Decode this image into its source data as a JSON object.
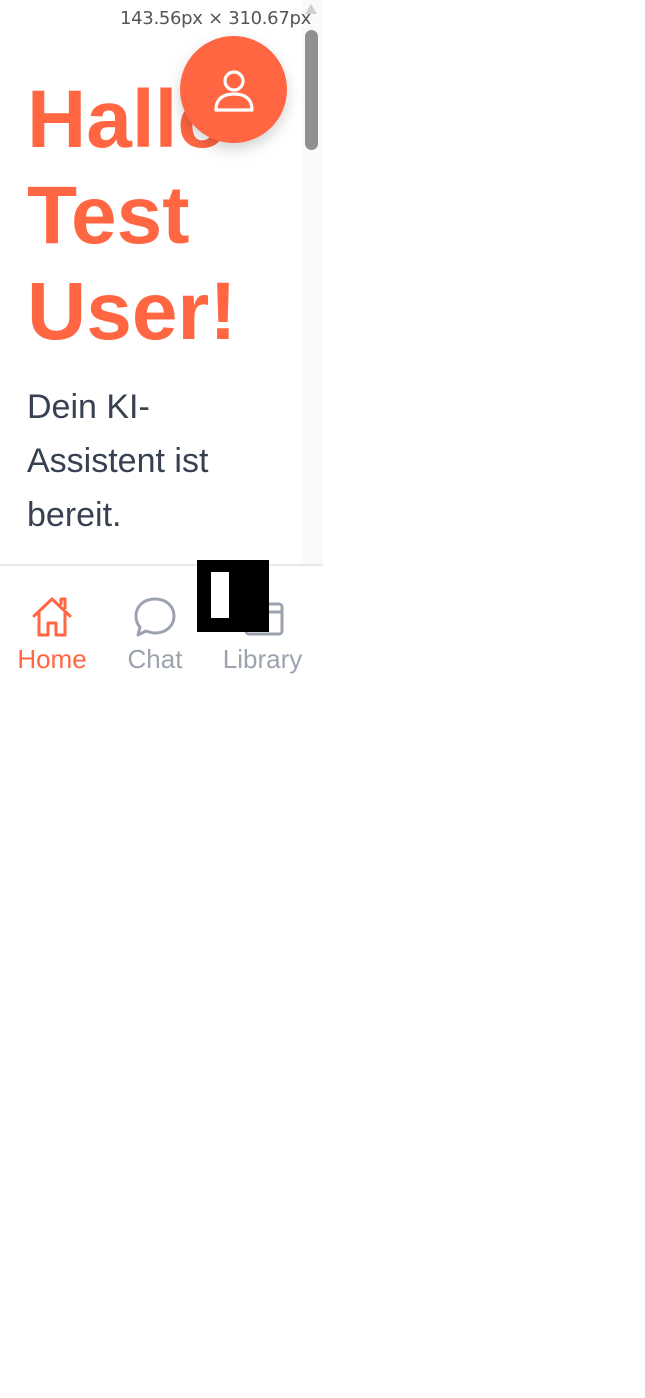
{
  "viewport_badge": "143.56px × 310.67px",
  "greeting": {
    "line1": "Hallo",
    "line2": "Test",
    "line3": "User!"
  },
  "subtitle": "Dein KI-Assistent ist bereit.",
  "profile_button": {
    "icon": "user-icon"
  },
  "bottom_nav": {
    "items": [
      {
        "label": "Home",
        "icon": "home-icon",
        "active": true
      },
      {
        "label": "Chat",
        "icon": "chat-bubble-icon",
        "active": false
      },
      {
        "label": "Library",
        "icon": "library-icon",
        "active": false
      }
    ]
  },
  "colors": {
    "accent": "#ff6641",
    "text": "#374151",
    "inactive": "#9ca3af"
  }
}
